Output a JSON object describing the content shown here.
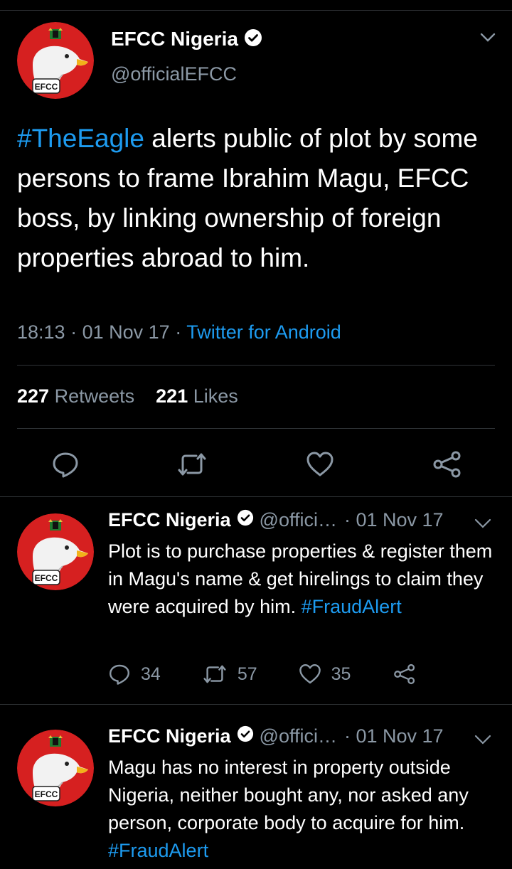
{
  "colors": {
    "background": "#000000",
    "accent": "#1d9bf0",
    "muted": "#8b98a5",
    "divider": "#2f3336"
  },
  "main_tweet": {
    "author": "EFCC Nigeria",
    "handle": "@officialEFCC",
    "hashtag": "#TheEagle",
    "body": " alerts public of plot by some persons to frame Ibrahim Magu, EFCC boss, by linking ownership of foreign properties abroad to him.",
    "time": "18:13",
    "date": "01 Nov 17",
    "source": "Twitter for Android",
    "retweets_count": "227",
    "retweets_label": "Retweets",
    "likes_count": "221",
    "likes_label": "Likes",
    "avatar_badge": "EFCC",
    "icons": [
      "reply-icon",
      "retweet-icon",
      "like-icon",
      "share-icon"
    ]
  },
  "replies": [
    {
      "author": "EFCC Nigeria",
      "handle": "@offici…",
      "date": "· 01 Nov 17",
      "body": "Plot is to purchase properties & register them in Magu's name & get hirelings to claim they were acquired by him. ",
      "hashtag": "#FraudAlert",
      "reply_count": "34",
      "retweet_count": "57",
      "like_count": "35",
      "avatar_badge": "EFCC"
    },
    {
      "author": "EFCC Nigeria",
      "handle": "@offici…",
      "date": "· 01 Nov 17",
      "body": "Magu has no interest in property outside Nigeria, neither bought any, nor asked any person, corporate body to acquire for him. ",
      "hashtag": "#FraudAlert",
      "avatar_badge": "EFCC"
    }
  ]
}
